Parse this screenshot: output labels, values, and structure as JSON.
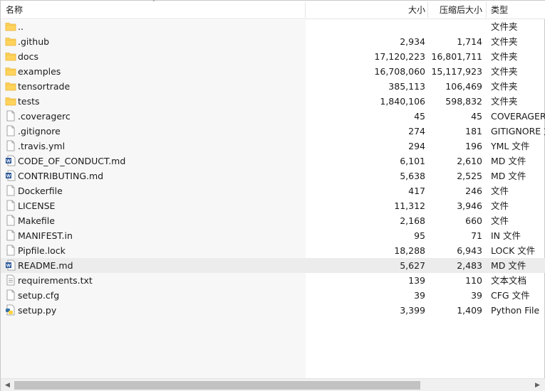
{
  "columns": {
    "name": "名称",
    "size": "大小",
    "compressed": "压缩后大小",
    "type": "类型"
  },
  "files": [
    {
      "icon": "folder-icon",
      "name": "..",
      "size": "",
      "compressed": "",
      "type": "文件夹",
      "selected": false
    },
    {
      "icon": "folder-icon",
      "name": ".github",
      "size": "2,934",
      "compressed": "1,714",
      "type": "文件夹",
      "selected": false
    },
    {
      "icon": "folder-icon",
      "name": "docs",
      "size": "17,120,223",
      "compressed": "16,801,711",
      "type": "文件夹",
      "selected": false
    },
    {
      "icon": "folder-icon",
      "name": "examples",
      "size": "16,708,060",
      "compressed": "15,117,923",
      "type": "文件夹",
      "selected": false
    },
    {
      "icon": "folder-icon",
      "name": "tensortrade",
      "size": "385,113",
      "compressed": "106,469",
      "type": "文件夹",
      "selected": false
    },
    {
      "icon": "folder-icon",
      "name": "tests",
      "size": "1,840,106",
      "compressed": "598,832",
      "type": "文件夹",
      "selected": false
    },
    {
      "icon": "blank-file-icon",
      "name": ".coveragerc",
      "size": "45",
      "compressed": "45",
      "type": "COVERAGERC 文件",
      "selected": false
    },
    {
      "icon": "blank-file-icon",
      "name": ".gitignore",
      "size": "274",
      "compressed": "181",
      "type": "GITIGNORE 文件",
      "selected": false
    },
    {
      "icon": "blank-file-icon",
      "name": ".travis.yml",
      "size": "294",
      "compressed": "196",
      "type": "YML 文件",
      "selected": false
    },
    {
      "icon": "word-doc-icon",
      "name": "CODE_OF_CONDUCT.md",
      "size": "6,101",
      "compressed": "2,610",
      "type": "MD 文件",
      "selected": false
    },
    {
      "icon": "word-doc-icon",
      "name": "CONTRIBUTING.md",
      "size": "5,638",
      "compressed": "2,525",
      "type": "MD 文件",
      "selected": false
    },
    {
      "icon": "blank-file-icon",
      "name": "Dockerfile",
      "size": "417",
      "compressed": "246",
      "type": "文件",
      "selected": false
    },
    {
      "icon": "blank-file-icon",
      "name": "LICENSE",
      "size": "11,312",
      "compressed": "3,946",
      "type": "文件",
      "selected": false
    },
    {
      "icon": "blank-file-icon",
      "name": "Makefile",
      "size": "2,168",
      "compressed": "660",
      "type": "文件",
      "selected": false
    },
    {
      "icon": "blank-file-icon",
      "name": "MANIFEST.in",
      "size": "95",
      "compressed": "71",
      "type": "IN 文件",
      "selected": false
    },
    {
      "icon": "blank-file-icon",
      "name": "Pipfile.lock",
      "size": "18,288",
      "compressed": "6,943",
      "type": "LOCK 文件",
      "selected": false
    },
    {
      "icon": "word-doc-icon",
      "name": "README.md",
      "size": "5,627",
      "compressed": "2,483",
      "type": "MD 文件",
      "selected": true
    },
    {
      "icon": "text-file-icon",
      "name": "requirements.txt",
      "size": "139",
      "compressed": "110",
      "type": "文本文档",
      "selected": false
    },
    {
      "icon": "blank-file-icon",
      "name": "setup.cfg",
      "size": "39",
      "compressed": "39",
      "type": "CFG 文件",
      "selected": false
    },
    {
      "icon": "python-file-icon",
      "name": "setup.py",
      "size": "3,399",
      "compressed": "1,409",
      "type": "Python File",
      "selected": false
    }
  ],
  "colors": {
    "folder": "#ffd35c",
    "folder_dark": "#e8b53a",
    "word_blue": "#2b579a",
    "selected_row": "#ececec",
    "name_pane": "#f7f7f7"
  }
}
